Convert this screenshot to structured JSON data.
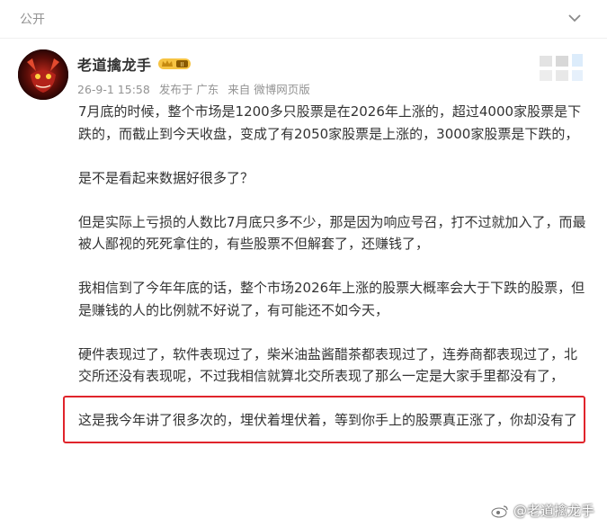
{
  "header": {
    "visibility": "公开",
    "more_icon": "chevron-down-icon"
  },
  "post": {
    "author": "老道擒龙手",
    "badge_icon": "vip-crown-badge-icon",
    "meta": {
      "date": "26-9-1 15:58",
      "location": "发布于 广东",
      "source": "来自 微博网页版"
    },
    "paragraphs": [
      "7月底的时候，整个市场是1200多只股票是在2026年上涨的，超过4000家股票是下跌的，而截止到今天收盘，变成了有2050家股票是上涨的，3000家股票是下跌的，",
      "是不是看起来数据好很多了？",
      "但是实际上亏损的人数比7月底只多不少，那是因为响应号召，打不过就加入了，而最被人鄙视的死死拿住的，有些股票不但解套了，还赚钱了，",
      "我相信到了今年年底的话，整个市场2026年上涨的股票大概率会大于下跌的股票，但是赚钱的人的比例就不好说了，有可能还不如今天，"
    ],
    "para5_line1": "硬件表现过了，软件表现过了，柴米油盐酱醋茶都表现过了，连券商都表现过了，",
    "para5_highlighted": "北交所还没有表现呢，不过我相信就算北交所表现了那么一定是大家手里都没有了，",
    "para6": "这是我今年讲了很多次的，埋伏着埋伏着，等到你手上的股票真正涨了，你却没有了"
  },
  "watermark": "@老道擒龙手",
  "colors": {
    "highlight_border": "#e0242b",
    "meta_text": "#939393",
    "body_text": "#333333"
  }
}
